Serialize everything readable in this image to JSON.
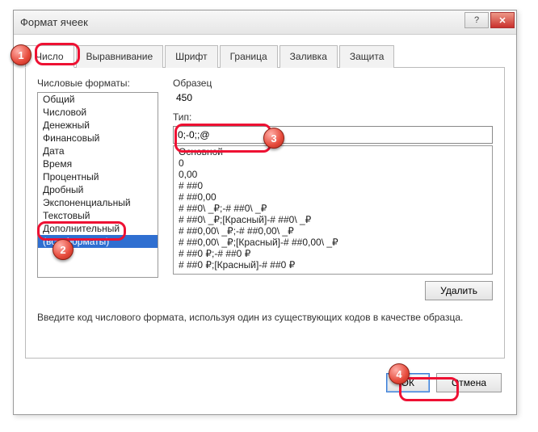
{
  "window": {
    "title": "Формат ячеек"
  },
  "tabs": [
    "Число",
    "Выравнивание",
    "Шрифт",
    "Граница",
    "Заливка",
    "Защита"
  ],
  "active_tab": 0,
  "categories_label": "Числовые форматы:",
  "categories": [
    "Общий",
    "Числовой",
    "Денежный",
    "Финансовый",
    "Дата",
    "Время",
    "Процентный",
    "Дробный",
    "Экспоненциальный",
    "Текстовый",
    "Дополнительный",
    "(все форматы)"
  ],
  "selected_category_index": 11,
  "sample": {
    "label": "Образец",
    "value": "450"
  },
  "type": {
    "label": "Тип:",
    "value": "0;-0;;@"
  },
  "type_options": [
    "Основной",
    "0",
    "0,00",
    "# ##0",
    "# ##0,00",
    "# ##0\\ _₽;-# ##0\\ _₽",
    "# ##0\\ _₽;[Красный]-# ##0\\ _₽",
    "# ##0,00\\ _₽;-# ##0,00\\ _₽",
    "# ##0,00\\ _₽;[Красный]-# ##0,00\\ _₽",
    "# ##0 ₽;-# ##0 ₽",
    "# ##0 ₽;[Красный]-# ##0 ₽"
  ],
  "delete_label": "Удалить",
  "hint": "Введите код числового формата, используя один из существующих кодов в качестве образца.",
  "buttons": {
    "ok": "ОК",
    "cancel": "Отмена"
  },
  "markers": [
    "1",
    "2",
    "3",
    "4"
  ]
}
